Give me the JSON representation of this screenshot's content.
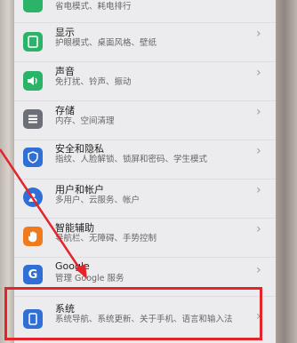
{
  "settings": {
    "items": [
      {
        "title": "",
        "subtitle": "省电模式、耗电排行",
        "icon": "battery-icon",
        "color": "#2bb36a"
      },
      {
        "title": "显示",
        "subtitle": "护眼模式、桌面风格、壁纸",
        "icon": "display-icon",
        "color": "#2bb36a"
      },
      {
        "title": "声音",
        "subtitle": "免打扰、铃声、振动",
        "icon": "sound-icon",
        "color": "#2bb36a"
      },
      {
        "title": "存储",
        "subtitle": "内存、空间清理",
        "icon": "storage-icon",
        "color": "#6d6f78"
      },
      {
        "title": "安全和隐私",
        "subtitle": "指纹、人脸解锁、锁屏和密码、学生模式",
        "icon": "shield-icon",
        "color": "#2f6fd6"
      },
      {
        "title": "用户和帐户",
        "subtitle": "多用户、云服务、帐户",
        "icon": "user-icon",
        "color": "#2f6fd6"
      },
      {
        "title": "智能辅助",
        "subtitle": "导航栏、无障碍、手势控制",
        "icon": "hand-icon",
        "color": "#f07a1e"
      },
      {
        "title": "Google",
        "subtitle": "管理 Google 服务",
        "icon": "google-icon",
        "color": "#2f6fd6"
      },
      {
        "title": "系统",
        "subtitle": "系统导航、系统更新、关于手机、语言和输入法",
        "icon": "phone-icon",
        "color": "#2f6fd6"
      }
    ],
    "chevron": "›"
  },
  "annotation": {
    "color": "#e4242a"
  }
}
